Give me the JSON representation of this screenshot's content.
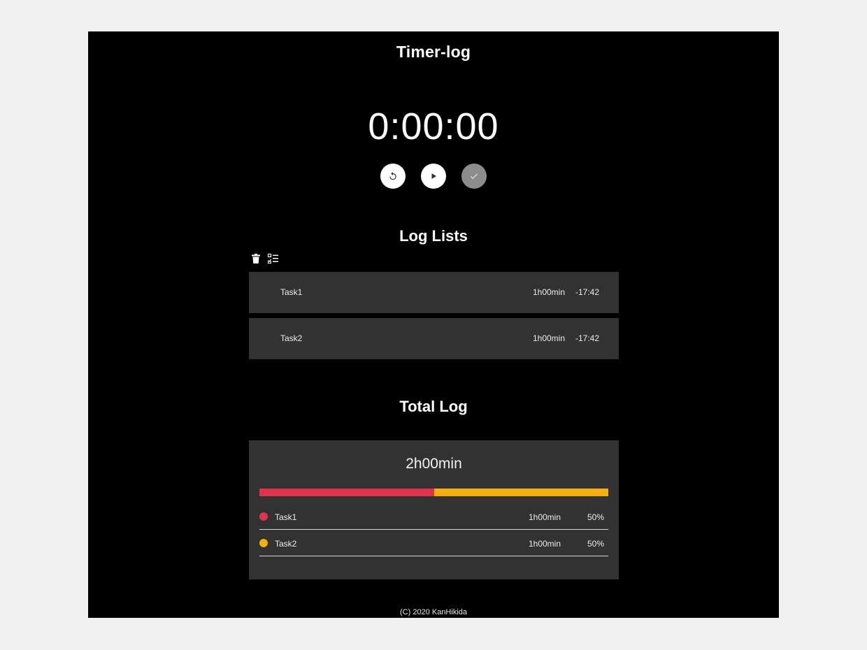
{
  "app": {
    "title": "Timer-log"
  },
  "timer": {
    "display": "0:00:00",
    "controls": [
      {
        "name": "reset",
        "icon": "reset-icon",
        "enabled": true
      },
      {
        "name": "play",
        "icon": "play-icon",
        "enabled": true
      },
      {
        "name": "complete",
        "icon": "check-icon",
        "enabled": false
      }
    ]
  },
  "log_lists": {
    "title": "Log Lists",
    "tools": [
      {
        "icon": "trash-icon"
      },
      {
        "icon": "checklist-icon"
      }
    ],
    "items": [
      {
        "name": "Task1",
        "duration": "1h00min",
        "time": "-17:42"
      },
      {
        "name": "Task2",
        "duration": "1h00min",
        "time": "-17:42"
      }
    ]
  },
  "total_log": {
    "title": "Total Log",
    "total": "2h00min",
    "items": [
      {
        "name": "Task1",
        "duration": "1h00min",
        "percent": "50%",
        "share": 0.5,
        "color": "#e0324b"
      },
      {
        "name": "Task2",
        "duration": "1h00min",
        "percent": "50%",
        "share": 0.5,
        "color": "#f5b00b"
      }
    ]
  },
  "footer": {
    "text": "(C) 2020 KanHikida"
  }
}
